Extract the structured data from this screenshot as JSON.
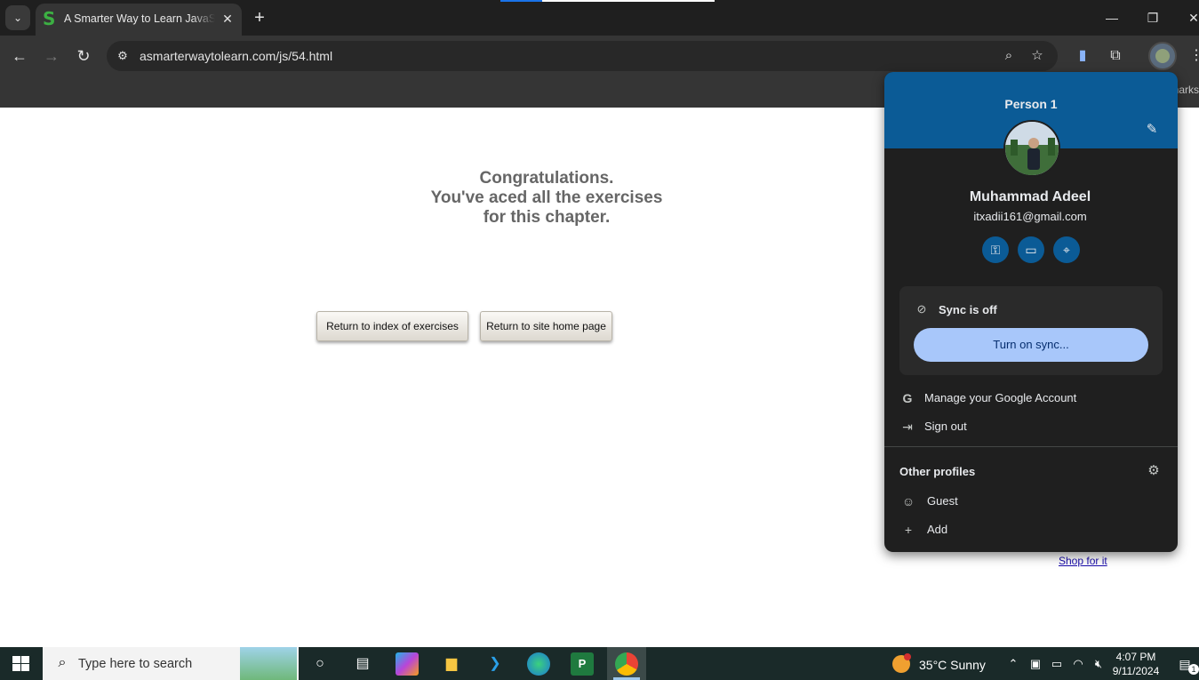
{
  "browser": {
    "tab": {
      "title": "A Smarter Way to Learn JavaScript",
      "favicon": "S",
      "close": "✕"
    },
    "tab_list_icon": "chevron-down-icon",
    "new_tab": "+",
    "window": {
      "minimize": "—",
      "restore": "❐",
      "close": "✕"
    },
    "url": "asmarterwaytolearn.com/js/54.html",
    "bookmarks_overflow": "marks"
  },
  "page": {
    "congrats_lines": [
      "Congratulations.",
      "You've aced all the exercises",
      "for this chapter."
    ],
    "button_index": "Return to index of exercises",
    "button_home": "Return to site home page",
    "shop_link": "Shop for it"
  },
  "profile_panel": {
    "header_title": "Person 1",
    "name": "Muhammad Adeel",
    "email": "itxadii161@gmail.com",
    "quick_icons": [
      "key-icon",
      "credit-card-icon",
      "location-pin-icon"
    ],
    "sync_status": "Sync is off",
    "sync_button": "Turn on sync...",
    "manage_account": "Manage your Google Account",
    "sign_out": "Sign out",
    "other_profiles_title": "Other profiles",
    "profiles": [
      "Guest",
      "Add"
    ],
    "accent_color": "#0b5b96",
    "sync_button_color": "#a8c7fa"
  },
  "taskbar": {
    "search_placeholder": "Type here to search",
    "weather": "35°C  Sunny",
    "time": "4:07 PM",
    "date": "9/11/2024",
    "notification_count": "1"
  }
}
